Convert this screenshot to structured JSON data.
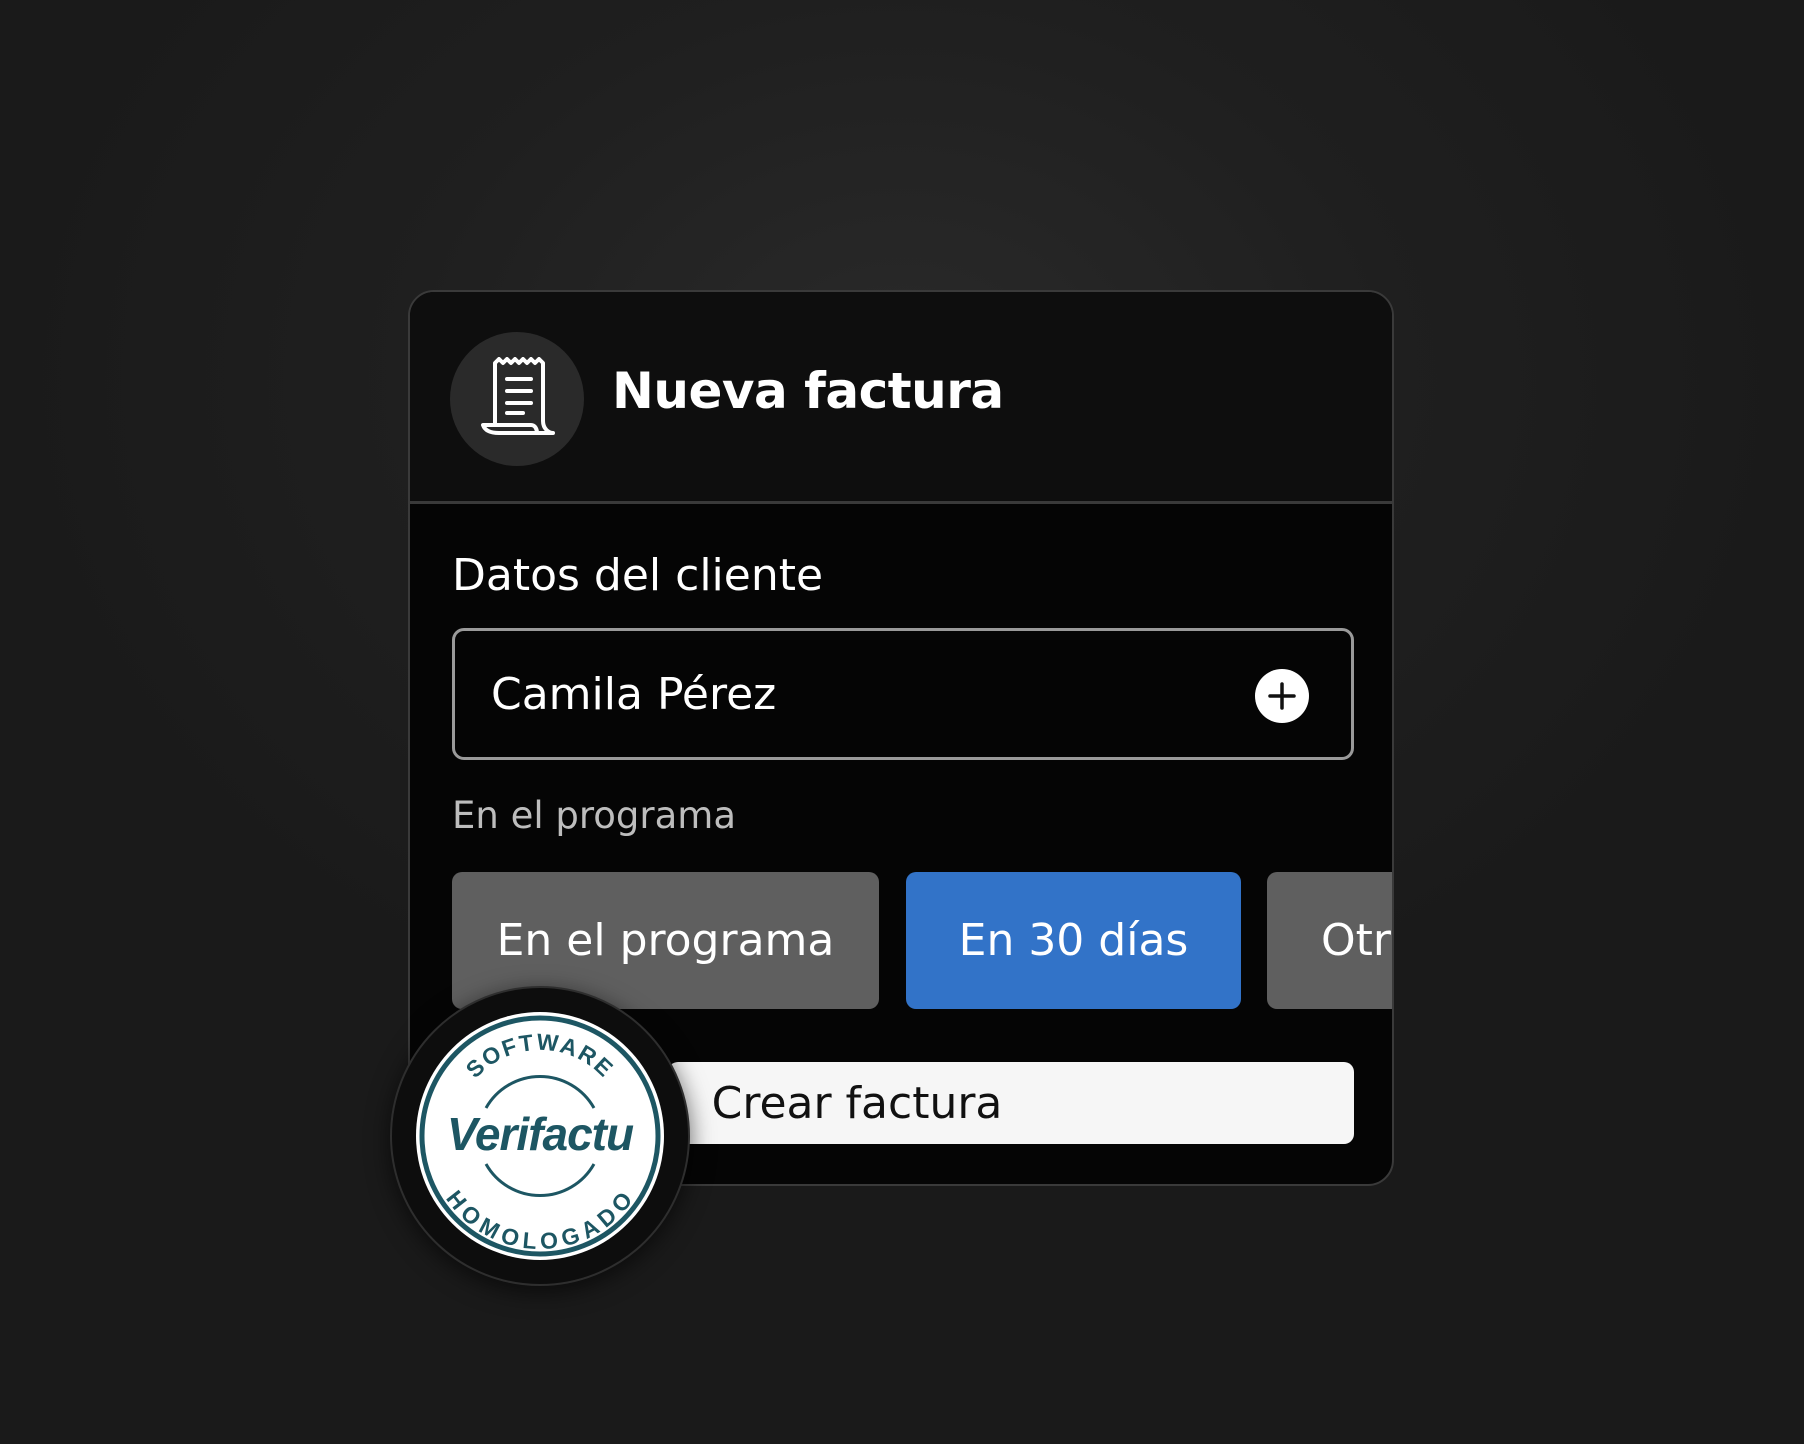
{
  "card": {
    "title": "Nueva factura",
    "header_icon": "receipt-icon"
  },
  "client": {
    "section_label": "Datos del cliente",
    "value": "Camila Pérez",
    "add_icon": "plus-circle-icon"
  },
  "terms": {
    "label": "En el programa",
    "options": [
      {
        "label": "En el programa",
        "selected": false
      },
      {
        "label": "En 30 días",
        "selected": true
      },
      {
        "label": "Otro",
        "selected": false
      }
    ]
  },
  "actions": {
    "create_label": "Crear factura"
  },
  "seal": {
    "top_text": "SOFTWARE",
    "center_text": "Verifactu",
    "bottom_text": "HOMOLOGADO"
  },
  "colors": {
    "accent_selected": "#3273c8",
    "option_default": "#5f5f5f",
    "seal_teal": "#1d5663"
  }
}
